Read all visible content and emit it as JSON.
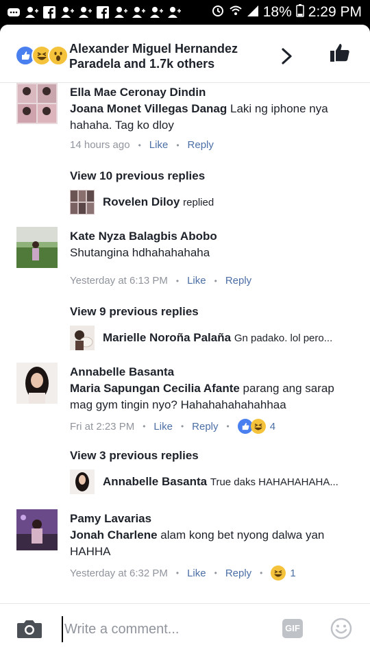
{
  "status_bar": {
    "battery": "18%",
    "time": "2:29 PM"
  },
  "header": {
    "names_line1": "Alexander Miguel Hernandez",
    "names_line2": "Paradela and 1.7k others"
  },
  "comments": [
    {
      "name": "Ella Mae Ceronay Dindin",
      "tag": "Joana Monet Villegas Danag",
      "text_line1": " Laki ng iphone nya",
      "text_line2": "hahaha. Tag ko dloy",
      "time": "14 hours ago",
      "like": "Like",
      "reply": "Reply",
      "view_more": "View 10 previous replies",
      "reply_name": "Rovelen Diloy",
      "reply_text": "replied"
    },
    {
      "name": "Kate Nyza Balagbis Abobo",
      "text_line1": "Shutangina hdhahahahaha",
      "time": "Yesterday at 6:13 PM",
      "like": "Like",
      "reply": "Reply",
      "view_more": "View 9 previous replies",
      "reply_name": "Marielle Noroña Palaña",
      "reply_text": "Gn padako. lol pero..."
    },
    {
      "name": "Annabelle Basanta",
      "tag": "Maria Sapungan Cecilia Afante",
      "text_line1": " parang ang sarap",
      "text_line2": "mag gym tingin nyo? Hahahahahahahhaa",
      "time": "Fri at 2:23 PM",
      "like": "Like",
      "reply": "Reply",
      "reaction_count": "4",
      "view_more": "View 3 previous replies",
      "reply_name": "Annabelle Basanta",
      "reply_text": "True daks HAHAHAHAHA..."
    },
    {
      "name": "Pamy Lavarias",
      "tag": "Jonah Charlene",
      "text_line1": " alam kong bet nyong dalwa yan",
      "text_line2": "HAHHA",
      "time": "Yesterday at 6:32 PM",
      "like": "Like",
      "reply": "Reply",
      "reaction_count": "1"
    }
  ],
  "composer": {
    "placeholder": "Write a comment...",
    "gif_label": "GIF"
  },
  "icons": [
    "camera-icon",
    "gif-icon",
    "smiley-icon",
    "thumbs-up-icon",
    "chevron-right-icon"
  ],
  "colors": {
    "link": "#4b6ea6",
    "meta": "#90949c",
    "like_blue": "#4a7ff0",
    "haha_yellow": "#f5c33b"
  }
}
